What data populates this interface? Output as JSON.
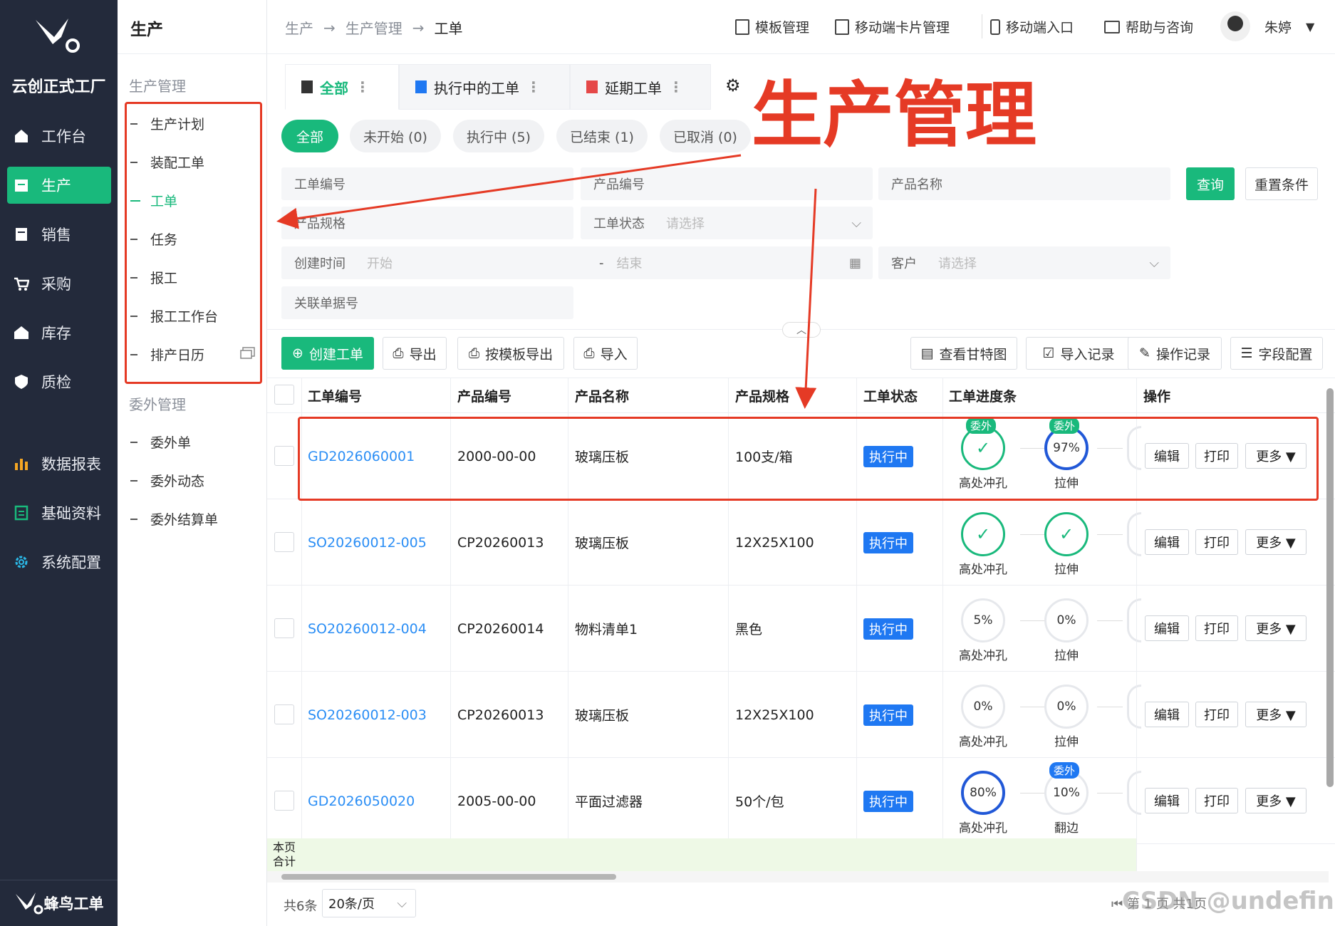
{
  "app": {
    "brand": "云创正式工厂",
    "footer": "蜂鸟工单"
  },
  "nav": [
    {
      "label": "工作台",
      "icon": "home-icon"
    },
    {
      "label": "生产",
      "icon": "production-icon"
    },
    {
      "label": "销售",
      "icon": "sales-icon"
    },
    {
      "label": "采购",
      "icon": "cart-icon"
    },
    {
      "label": "库存",
      "icon": "warehouse-icon"
    },
    {
      "label": "质检",
      "icon": "quality-icon"
    },
    {
      "label": "数据报表",
      "icon": "chart-icon"
    },
    {
      "label": "基础资料",
      "icon": "doc-icon"
    },
    {
      "label": "系统配置",
      "icon": "gear-icon"
    }
  ],
  "side": {
    "title": "生产",
    "group1": "生产管理",
    "items1": [
      "生产计划",
      "装配工单",
      "工单",
      "任务",
      "报工",
      "报工工作台",
      "排产日历"
    ],
    "group2": "委外管理",
    "items2": [
      "委外单",
      "委外动态",
      "委外结算单"
    ]
  },
  "breadcrumb": [
    "生产",
    "生产管理",
    "工单"
  ],
  "arrow": "→",
  "toplinks": [
    "模板管理",
    "移动端卡片管理",
    "移动端入口",
    "帮助与咨询"
  ],
  "user": "朱婷",
  "tabs": [
    "全部",
    "执行中的工单",
    "延期工单"
  ],
  "chips": [
    "全部",
    "未开始 (0)",
    "执行中 (5)",
    "已结束 (1)",
    "已取消 (0)"
  ],
  "annotation": "生产管理",
  "form": {
    "wo_no": "工单编号",
    "prod_no": "产品编号",
    "prod_name": "产品名称",
    "spec": "产品规格",
    "status": "工单状态",
    "status_ph": "请选择",
    "created": "创建时间",
    "start": "开始",
    "dash": "-",
    "end": "结束",
    "customer": "客户",
    "customer_ph": "请选择",
    "related": "关联单据号",
    "query": "查询",
    "reset": "重置条件"
  },
  "toolbar": {
    "create": "创建工单",
    "export": "导出",
    "tpl_export": "按模板导出",
    "import": "导入",
    "gantt": "查看甘特图",
    "import_log": "导入记录",
    "op_log": "操作记录",
    "fields": "字段配置"
  },
  "columns": [
    "工单编号",
    "产品编号",
    "产品名称",
    "产品规格",
    "工单状态",
    "工单进度条",
    "操作"
  ],
  "rows": [
    {
      "wo": "GD2026060001",
      "pn": "2000-00-00",
      "name": "玻璃压板",
      "spec": "100支/箱",
      "status": "执行中",
      "p1": "",
      "p1l": "高处冲孔",
      "p1tag": "委外",
      "p2": "97%",
      "p2l": "拉伸",
      "p2tag": "委外"
    },
    {
      "wo": "SO20260012-005",
      "pn": "CP20260013",
      "name": "玻璃压板",
      "spec": "12X25X100",
      "status": "执行中",
      "p1": "",
      "p1l": "高处冲孔",
      "p1tag": "",
      "p2": "",
      "p2l": "拉伸",
      "p2tag": ""
    },
    {
      "wo": "SO20260012-004",
      "pn": "CP20260014",
      "name": "物料清单1",
      "spec": "黑色",
      "status": "执行中",
      "p1": "5%",
      "p1l": "高处冲孔",
      "p1tag": "",
      "p2": "0%",
      "p2l": "拉伸",
      "p2tag": ""
    },
    {
      "wo": "SO20260012-003",
      "pn": "CP20260013",
      "name": "玻璃压板",
      "spec": "12X25X100",
      "status": "执行中",
      "p1": "0%",
      "p1l": "高处冲孔",
      "p1tag": "",
      "p2": "0%",
      "p2l": "拉伸",
      "p2tag": ""
    },
    {
      "wo": "GD2026050020",
      "pn": "2005-00-00",
      "name": "平面过滤器",
      "spec": "50个/包",
      "status": "执行中",
      "p1": "80%",
      "p1l": "高处冲孔",
      "p1tag": "",
      "p2": "10%",
      "p2l": "翻边",
      "p2tag": "委外"
    }
  ],
  "ops": {
    "edit": "编辑",
    "print": "打印",
    "more": "更多 ▼"
  },
  "summary": "本页\n合计",
  "pager": {
    "total": "共6条",
    "size": "20条/页",
    "tail": "第 1 页 共1页",
    "watermark": "CSDN @undefined"
  }
}
